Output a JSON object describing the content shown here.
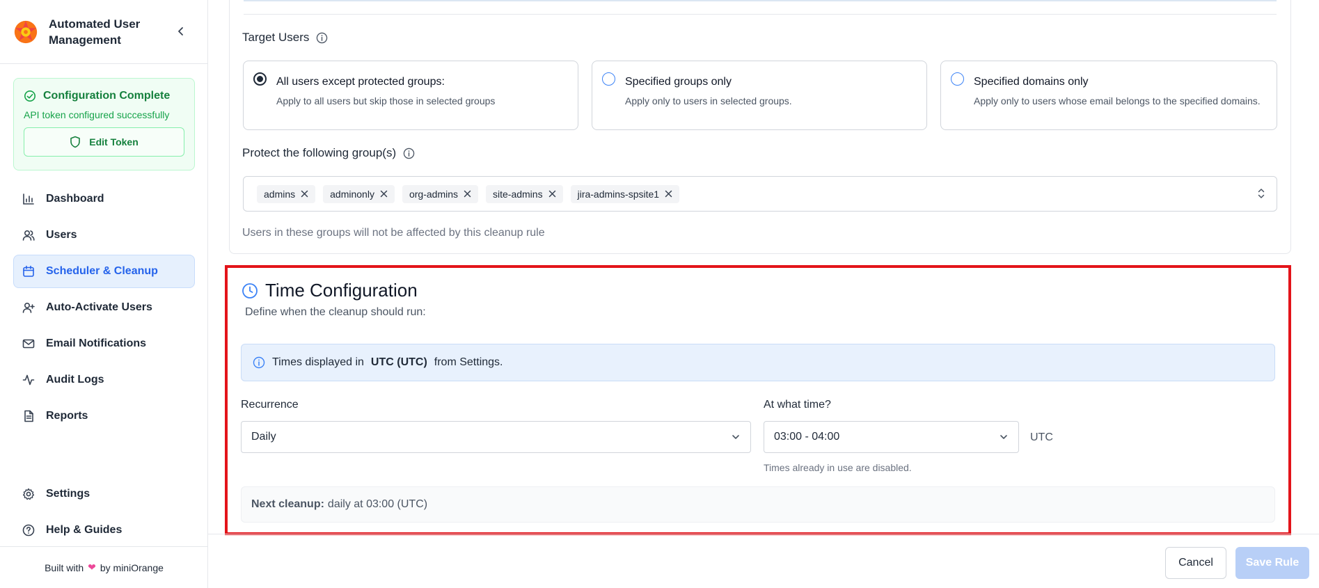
{
  "app": {
    "title": "Automated User Management"
  },
  "config_card": {
    "title": "Configuration Complete",
    "subtitle": "API token configured successfully",
    "edit_label": "Edit Token"
  },
  "nav": {
    "items": [
      {
        "label": "Dashboard",
        "icon": "bar-chart-icon"
      },
      {
        "label": "Users",
        "icon": "users-icon"
      },
      {
        "label": "Scheduler & Cleanup",
        "icon": "calendar-icon",
        "active": true
      },
      {
        "label": "Auto-Activate Users",
        "icon": "user-plus-icon"
      },
      {
        "label": "Email Notifications",
        "icon": "mail-icon"
      },
      {
        "label": "Audit Logs",
        "icon": "activity-icon"
      },
      {
        "label": "Reports",
        "icon": "file-text-icon"
      }
    ],
    "bottom_items": [
      {
        "label": "Settings",
        "icon": "gear-icon"
      },
      {
        "label": "Help & Guides",
        "icon": "help-circle-icon"
      }
    ]
  },
  "footer_brand": {
    "prefix": "Built with",
    "suffix": "by miniOrange"
  },
  "target_users": {
    "label": "Target Users",
    "options": [
      {
        "title": "All users except protected groups:",
        "description": "Apply to all users but skip those in selected groups",
        "checked": true
      },
      {
        "title": "Specified groups only",
        "description": "Apply only to users in selected groups.",
        "checked": false
      },
      {
        "title": "Specified domains only",
        "description": "Apply only to users whose email belongs to the specified domains.",
        "checked": false
      }
    ]
  },
  "protect_groups": {
    "label": "Protect the following group(s)",
    "tags": [
      "admins",
      "adminonly",
      "org-admins",
      "site-admins",
      "jira-admins-spsite1"
    ],
    "helper": "Users in these groups will not be affected by this cleanup rule"
  },
  "time_config": {
    "title": "Time Configuration",
    "subtitle": "Define when the cleanup should run:",
    "info_prefix": "Times displayed in",
    "info_timezone": "UTC (UTC)",
    "info_suffix": "from Settings.",
    "recurrence_label": "Recurrence",
    "recurrence_value": "Daily",
    "time_label": "At what time?",
    "time_value": "03:00 - 04:00",
    "time_unit": "UTC",
    "time_note": "Times already in use are disabled.",
    "next_label": "Next cleanup:",
    "next_value": "daily at 03:00 (UTC)"
  },
  "actions": {
    "cancel": "Cancel",
    "save": "Save Rule"
  },
  "colors": {
    "accent": "#2563eb",
    "success": "#15803d",
    "highlight_border": "#e3141a",
    "save_disabled": "#b8cff7"
  }
}
